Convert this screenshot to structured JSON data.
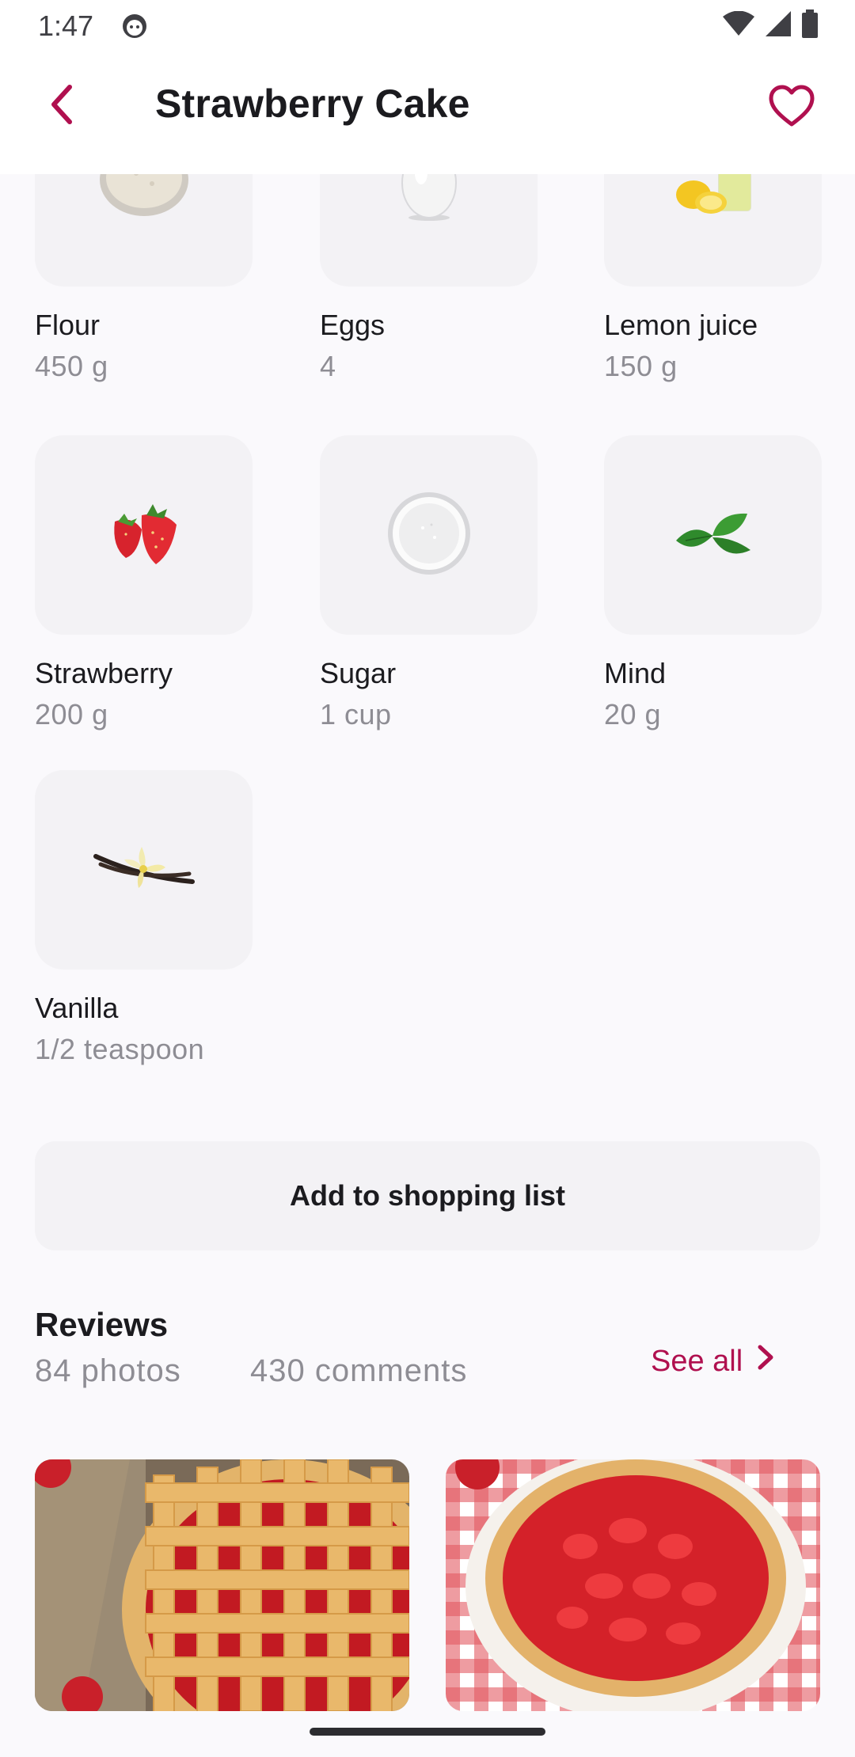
{
  "status": {
    "time": "1:47"
  },
  "header": {
    "title": "Strawberry Cake"
  },
  "ingredients": [
    {
      "name": "Flour",
      "qty": "450 g",
      "icon": "flour-bowl-icon"
    },
    {
      "name": "Eggs",
      "qty": "4",
      "icon": "egg-icon"
    },
    {
      "name": "Lemon juice",
      "qty": "150 g",
      "icon": "lemon-juice-icon"
    },
    {
      "name": "Strawberry",
      "qty": "200 g",
      "icon": "strawberry-icon"
    },
    {
      "name": "Sugar",
      "qty": "1 cup",
      "icon": "sugar-bowl-icon"
    },
    {
      "name": "Mind",
      "qty": "20 g",
      "icon": "mint-leaves-icon"
    },
    {
      "name": "Vanilla",
      "qty": "1/2 teaspoon",
      "icon": "vanilla-icon"
    }
  ],
  "actions": {
    "add_to_shopping_list": "Add to shopping list"
  },
  "reviews": {
    "title": "Reviews",
    "photos": "84 photos",
    "comments": "430 comments",
    "see_all": "See all"
  },
  "colors": {
    "accent": "#b0104f",
    "tile_bg": "#f3f2f5",
    "muted_text": "#8e8d94"
  }
}
